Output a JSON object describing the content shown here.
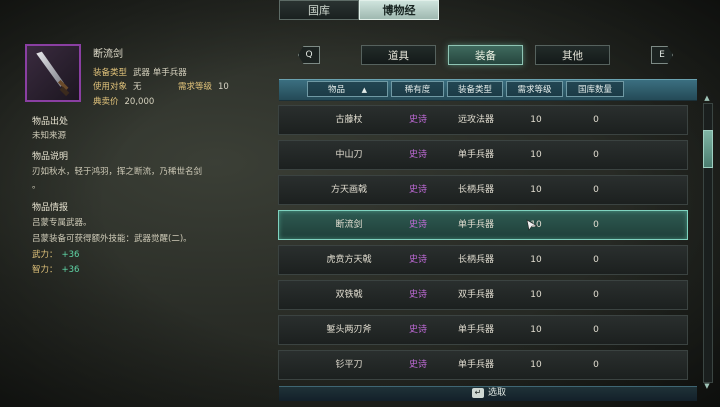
{
  "top_tabs": [
    {
      "label": "国库",
      "active": false
    },
    {
      "label": "博物经",
      "active": true
    }
  ],
  "item": {
    "name": "断流剑",
    "icon": "sword-icon",
    "rarity_color": "#8a3fa2",
    "stats": [
      {
        "label": "装备类型",
        "value": "武器  单手兵器"
      },
      {
        "label": "使用对象",
        "value": "无"
      },
      {
        "label": "典卖价",
        "value": "20,000"
      }
    ],
    "requirement": {
      "label": "需求等级",
      "value": "10"
    },
    "origin_title": "物品出处",
    "origin_text": "未知来源",
    "desc_title": "物品说明",
    "desc_lines": [
      "刃如秋水，轻于鸿羽，挥之断流，乃稀世名剑",
      "。"
    ],
    "info_title": "物品情报",
    "info_lines": [
      "吕蒙专属武器。",
      "吕蒙装备可获得额外技能：武器觉醒(二)。"
    ],
    "bonuses": [
      {
        "label": "武力：",
        "value": "+36"
      },
      {
        "label": "智力：",
        "value": "+36"
      }
    ]
  },
  "category_tabs": {
    "prev_key": "Q",
    "next_key": "E",
    "tabs": [
      {
        "label": "道具",
        "active": false
      },
      {
        "label": "装备",
        "active": true
      },
      {
        "label": "其他",
        "active": false
      }
    ]
  },
  "columns": [
    "物品",
    "稀有度",
    "装备类型",
    "需求等级",
    "国库数量"
  ],
  "sort_indicator": "▲",
  "rows": [
    {
      "name": "古藤杖",
      "rarity": "史诗",
      "type": "远攻法器",
      "level": "10",
      "count": "0",
      "selected": false
    },
    {
      "name": "中山刀",
      "rarity": "史诗",
      "type": "单手兵器",
      "level": "10",
      "count": "0",
      "selected": false
    },
    {
      "name": "方天画戟",
      "rarity": "史诗",
      "type": "长柄兵器",
      "level": "10",
      "count": "0",
      "selected": false
    },
    {
      "name": "断流剑",
      "rarity": "史诗",
      "type": "单手兵器",
      "level": "10",
      "count": "0",
      "selected": true
    },
    {
      "name": "虎贲方天戟",
      "rarity": "史诗",
      "type": "长柄兵器",
      "level": "10",
      "count": "0",
      "selected": false
    },
    {
      "name": "双铁戟",
      "rarity": "史诗",
      "type": "双手兵器",
      "level": "10",
      "count": "0",
      "selected": false
    },
    {
      "name": "錾头两刃斧",
      "rarity": "史诗",
      "type": "单手兵器",
      "level": "10",
      "count": "0",
      "selected": false
    },
    {
      "name": "钐平刀",
      "rarity": "史诗",
      "type": "单手兵器",
      "level": "10",
      "count": "0",
      "selected": false
    }
  ],
  "colors": {
    "rarity_epic": "#c16bd9",
    "accent": "#7fd2bf",
    "bonus": "#5fd6a7"
  },
  "hint": {
    "key": "↵",
    "label": "选取"
  }
}
